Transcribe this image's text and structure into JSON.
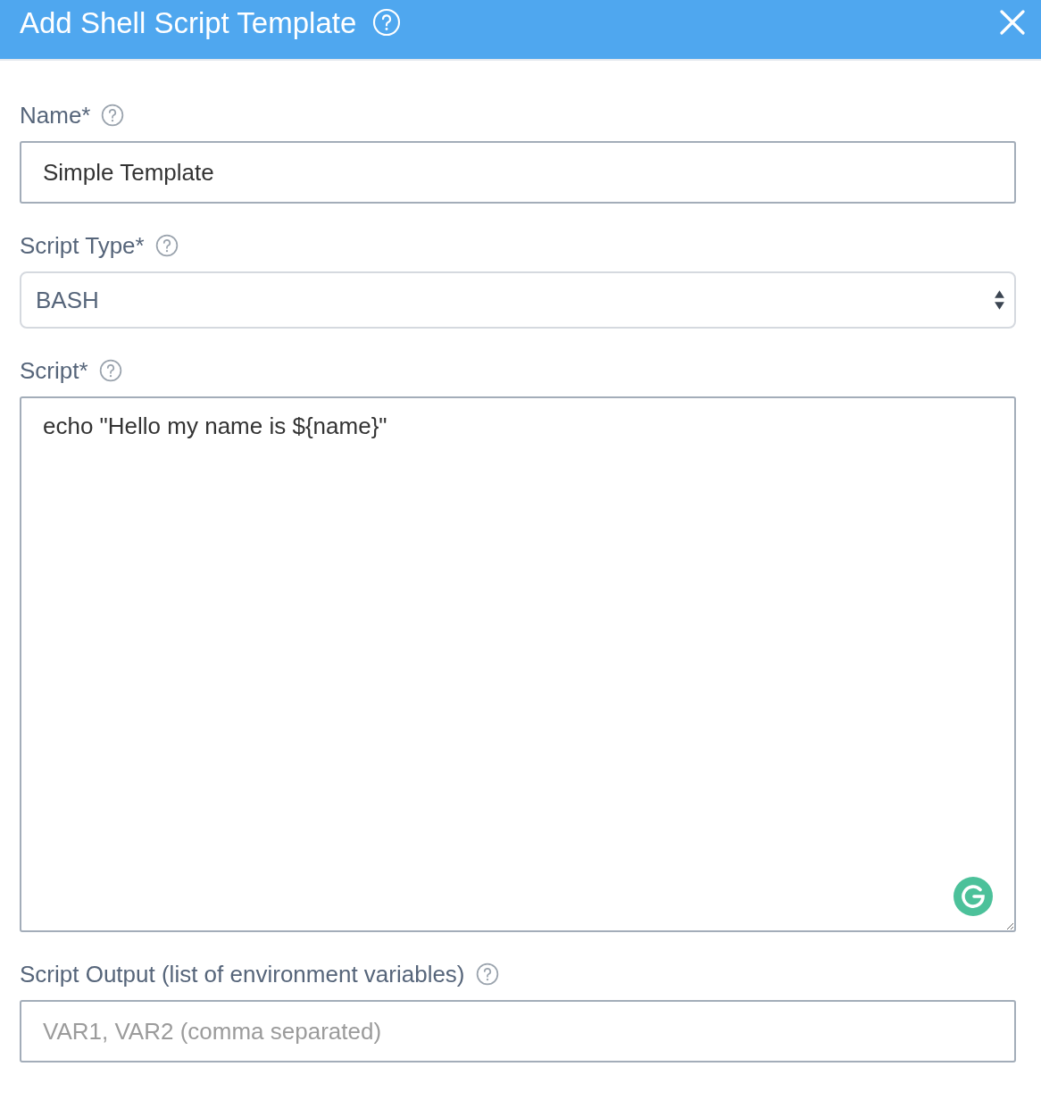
{
  "dialog": {
    "title": "Add Shell Script Template"
  },
  "fields": [
    {
      "kind": "text",
      "label": "Name*",
      "value": "Simple Template"
    },
    {
      "kind": "select",
      "label": "Script Type*",
      "value": "BASH"
    },
    {
      "kind": "textarea",
      "label": "Script*",
      "value": "echo \"Hello my name is ${name}\""
    },
    {
      "kind": "text",
      "label": "Script Output (list of environment variables)",
      "placeholder": "VAR1, VAR2 (comma separated)"
    }
  ]
}
